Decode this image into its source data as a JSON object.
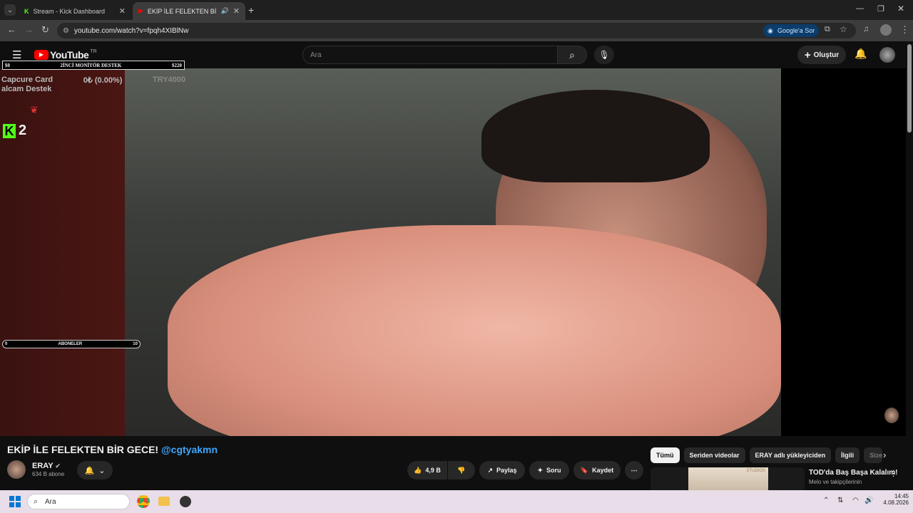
{
  "browser": {
    "tabs": [
      {
        "label": "Stream - Kick Dashboard"
      },
      {
        "label": "EKİP İLE FELEKTEN BİR GECE"
      }
    ],
    "url": "youtube.com/watch?v=fpqh4XIBlNw",
    "google_ask": "Google'a Sor"
  },
  "youtube": {
    "logo": "YouTube",
    "region": "TR",
    "search_placeholder": "Ara",
    "create_label": "Oluştur"
  },
  "overlay": {
    "goal_min": "$0",
    "goal_title": "2İNCİ MONİTÖR DESTEK",
    "goal_max": "$220",
    "capture_line1": "Capcure Card",
    "capture_amount": "0₺ (0.00%)",
    "capture_target": "TRY4000",
    "capture_line2": "alcam Destek",
    "kick_count": "2",
    "subs_min": "0",
    "subs_label": "ABONELER",
    "subs_max": "10"
  },
  "video": {
    "title": "EKİP İLE FELEKTEN BİR GECE!",
    "mention": "@cgtyakmn",
    "channel": "ERAY",
    "subscribers": "634 B abone",
    "likes": "4,9 B",
    "share": "Paylaş",
    "ask": "Soru",
    "save": "Kaydet"
  },
  "chips": [
    "Tümü",
    "Seriden videolar",
    "ERAY adlı yükleyiciden",
    "İlgili",
    "Size"
  ],
  "recommendation": {
    "title": "TOD'da Baş Başa Kalalım!",
    "sub": "Melo ve takipçilerinin",
    "thumb_label": "STUDIOS"
  },
  "taskbar": {
    "search": "Ara",
    "time": "14:45",
    "date": "4.08.2026"
  },
  "colors": {
    "accent_blue": "#3ea6ff",
    "kick_green": "#53fc18",
    "yt_red": "#ff0000"
  }
}
